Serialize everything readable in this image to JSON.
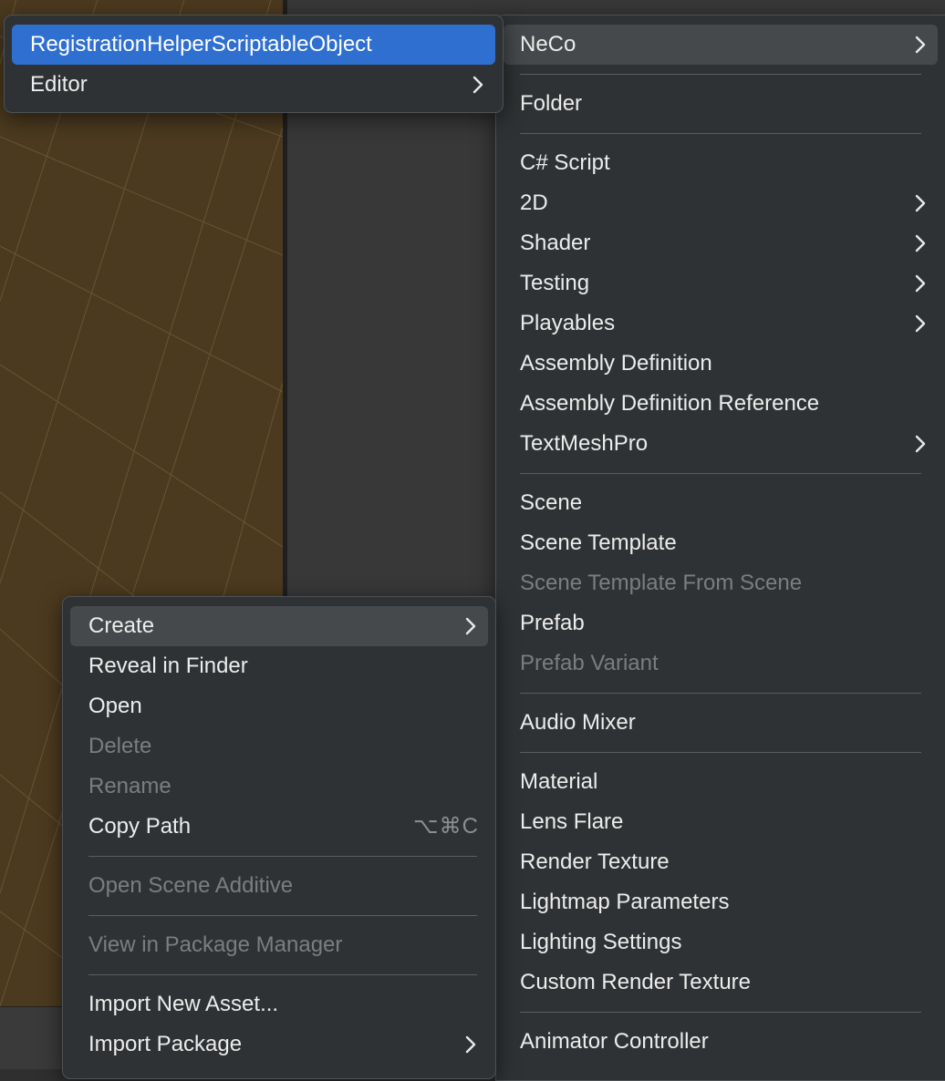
{
  "neco_submenu": {
    "items": [
      {
        "label": "RegistrationHelperScriptableObject",
        "selected": true,
        "submenu": false
      },
      {
        "label": "Editor",
        "selected": false,
        "submenu": true
      }
    ]
  },
  "create_submenu": {
    "items": [
      {
        "label": "NeCo",
        "submenu": true,
        "hovered": true
      },
      {
        "label": "Folder"
      },
      {
        "label": "C# Script"
      },
      {
        "label": "2D",
        "submenu": true
      },
      {
        "label": "Shader",
        "submenu": true
      },
      {
        "label": "Testing",
        "submenu": true
      },
      {
        "label": "Playables",
        "submenu": true
      },
      {
        "label": "Assembly Definition"
      },
      {
        "label": "Assembly Definition Reference"
      },
      {
        "label": "TextMeshPro",
        "submenu": true
      },
      {
        "label": "Scene"
      },
      {
        "label": "Scene Template"
      },
      {
        "label": "Scene Template From Scene",
        "disabled": true
      },
      {
        "label": "Prefab"
      },
      {
        "label": "Prefab Variant",
        "disabled": true
      },
      {
        "label": "Audio Mixer"
      },
      {
        "label": "Material"
      },
      {
        "label": "Lens Flare"
      },
      {
        "label": "Render Texture"
      },
      {
        "label": "Lightmap Parameters"
      },
      {
        "label": "Lighting Settings"
      },
      {
        "label": "Custom Render Texture"
      },
      {
        "label": "Animator Controller"
      }
    ]
  },
  "context_menu": {
    "items": [
      {
        "label": "Create",
        "submenu": true,
        "hovered": true
      },
      {
        "label": "Reveal in Finder"
      },
      {
        "label": "Open"
      },
      {
        "label": "Delete",
        "disabled": true
      },
      {
        "label": "Rename",
        "disabled": true
      },
      {
        "label": "Copy Path",
        "shortcut": "⌥⌘C"
      },
      {
        "label": "Open Scene Additive",
        "disabled": true
      },
      {
        "label": "View in Package Manager",
        "disabled": true
      },
      {
        "label": "Import New Asset..."
      },
      {
        "label": "Import Package",
        "submenu": true
      }
    ]
  },
  "colors": {
    "menu_bg": "#2f3234",
    "selected_bg": "#2f6fd0",
    "hover_bg": "#46494b",
    "text": "#ececec",
    "disabled_text": "#7b7d7f",
    "scene_bg": "#4b3a1f"
  },
  "icons": {
    "submenu_arrow": "chevron-right-icon"
  }
}
